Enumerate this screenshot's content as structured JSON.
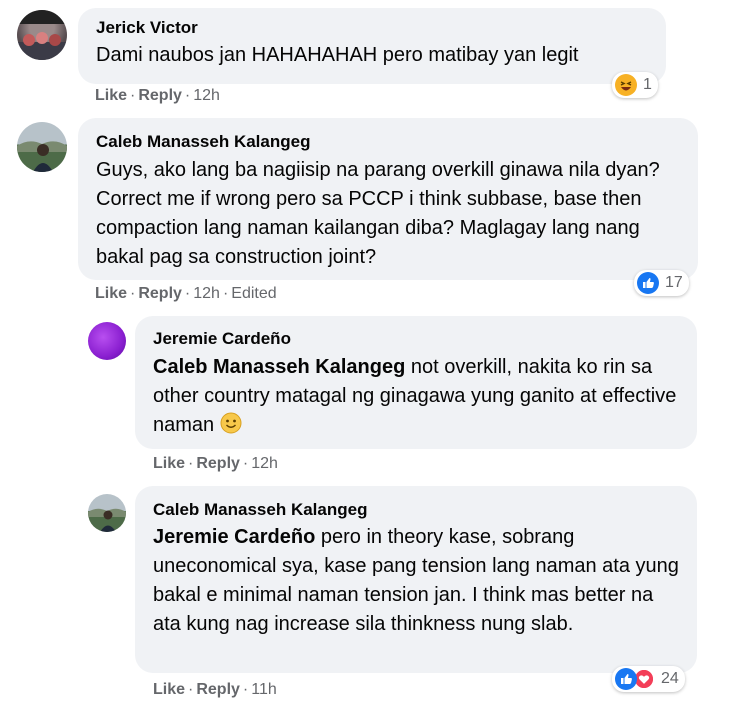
{
  "comments": [
    {
      "author": "Jerick Victor",
      "text": "Dami naubos jan HAHAHAHAH pero matibay yan legit",
      "like": "Like",
      "reply": "Reply",
      "time": "12h",
      "reaction_count": "1",
      "reaction_icon": "haha-emoji-icon"
    },
    {
      "author": "Caleb Manasseh Kalangeg",
      "text": "Guys, ako lang ba nagiisip na parang overkill ginawa nila dyan? Correct me if wrong pero sa PCCP i think subbase, base then compaction lang naman kailangan diba? Maglagay lang nang bakal pag sa construction joint?",
      "like": "Like",
      "reply": "Reply",
      "time": "12h",
      "edited": "Edited",
      "reaction_count": "17",
      "reaction_icon": "like-thumb-icon"
    },
    {
      "author": "Jeremie Cardeño",
      "mention": "Caleb Manasseh Kalangeg",
      "text": " not overkill, nakita ko rin sa other country matagal ng ginagawa yung ganito at effective naman ",
      "emoji": "🙂",
      "like": "Like",
      "reply": "Reply",
      "time": "12h"
    },
    {
      "author": "Caleb Manasseh Kalangeg",
      "mention": "Jeremie Cardeño",
      "text": " pero in theory kase, sobrang uneconomical sya, kase pang tension lang naman ata yung bakal e minimal naman tension jan. I think mas better na ata kung nag increase sila thinkness nung slab.",
      "like": "Like",
      "reply": "Reply",
      "time": "11h",
      "reaction_count": "24",
      "reaction_icons": [
        "like-thumb-icon",
        "heart-icon"
      ]
    }
  ],
  "colors": {
    "bubble_bg": "#f0f2f5",
    "meta_text": "#65676b",
    "like_blue": "#1877f2",
    "love_red": "#f33e58",
    "haha_yellow": "#f7b125"
  },
  "separator": "·"
}
